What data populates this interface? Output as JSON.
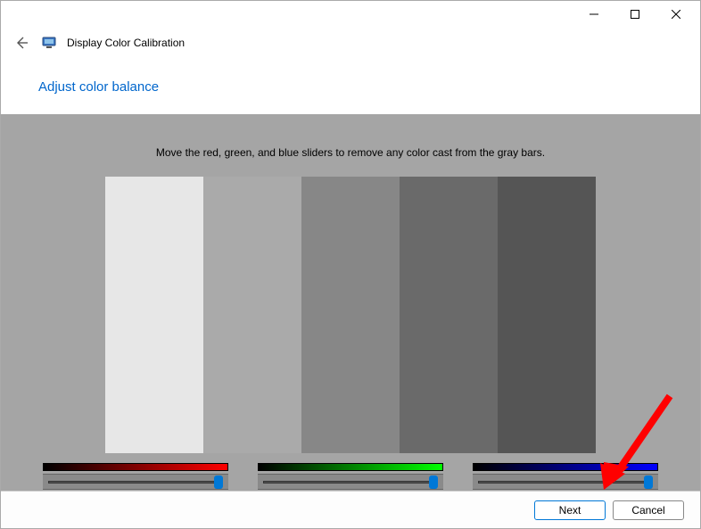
{
  "window": {
    "title": "Display Color Calibration"
  },
  "page": {
    "heading": "Adjust color balance",
    "instruction": "Move the red, green, and blue sliders to remove any color cast from the gray bars."
  },
  "gray_bars": [
    "#e7e7e7",
    "#aaaaaa",
    "#878787",
    "#6a6a6a",
    "#555555"
  ],
  "sliders": {
    "red": {
      "value_percent": 100
    },
    "green": {
      "value_percent": 100
    },
    "blue": {
      "value_percent": 100
    }
  },
  "footer": {
    "next_label": "Next",
    "cancel_label": "Cancel"
  }
}
